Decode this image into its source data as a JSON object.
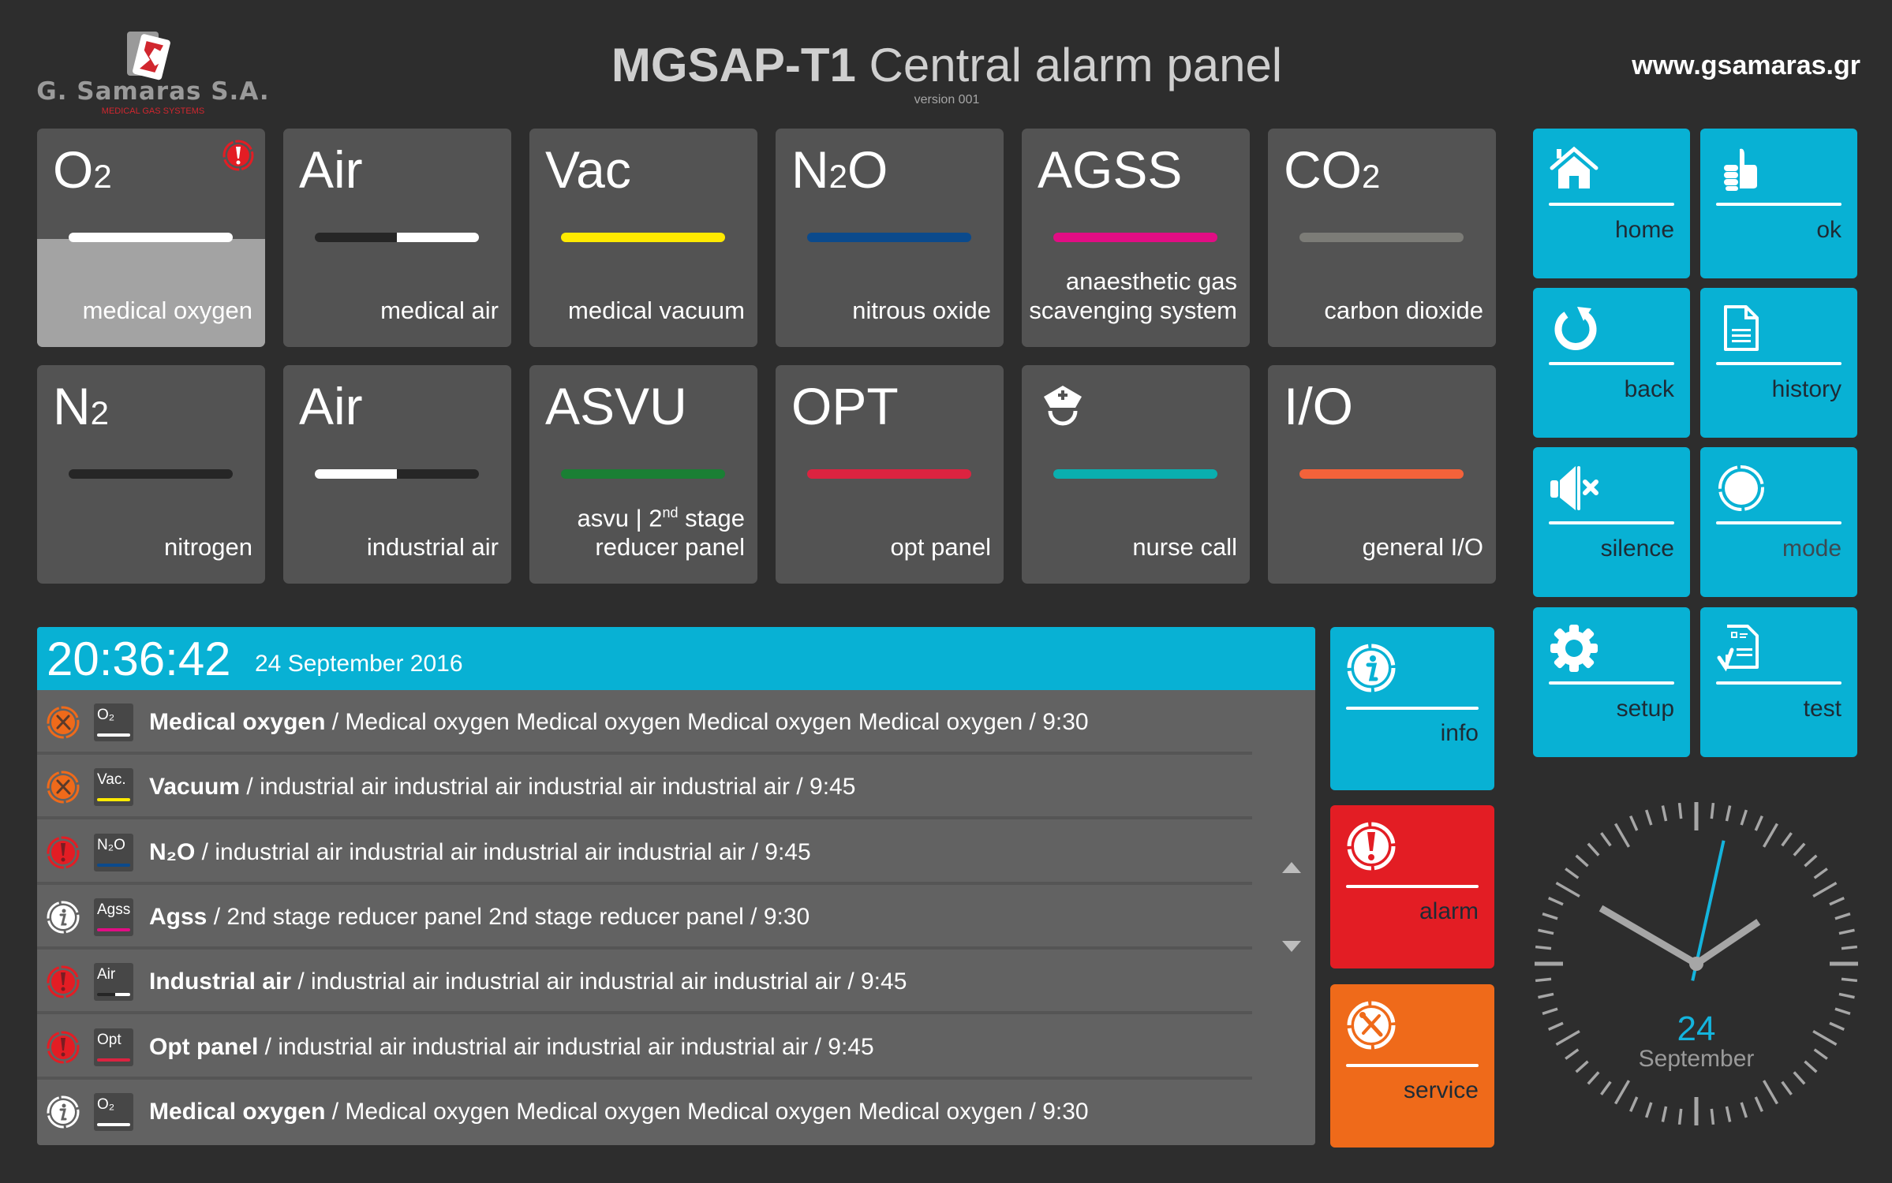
{
  "header": {
    "logo_name": "G. Samaras S.A.",
    "logo_tagline": "MEDICAL GAS SYSTEMS",
    "title_bold": "MGSAP-T1",
    "title_rest": "Central alarm panel",
    "version": "version 001",
    "website": "www.gsamaras.gr"
  },
  "tiles": [
    {
      "code": "O",
      "sub": "2",
      "desc": "medical oxygen",
      "bar": [
        "#ffffff"
      ],
      "selected": true,
      "alert": true
    },
    {
      "code": "Air",
      "sub": "",
      "desc": "medical air",
      "bar": [
        "#262626",
        "#ffffff"
      ]
    },
    {
      "code": "Vac",
      "sub": "",
      "desc": "medical vacuum",
      "bar": [
        "#ffea00"
      ]
    },
    {
      "code": "N",
      "sub": "2",
      "code_after": "O",
      "desc": "nitrous oxide",
      "bar": [
        "#0b4a8c"
      ]
    },
    {
      "code": "AGSS",
      "sub": "",
      "desc_line1": "anaesthetic gas",
      "desc": "scavenging system",
      "bar": [
        "#e20d84"
      ]
    },
    {
      "code": "CO",
      "sub": "2",
      "desc": "carbon dioxide",
      "bar": [
        "#7c7c77"
      ]
    },
    {
      "code": "N",
      "sub": "2",
      "desc": "nitrogen",
      "bar": [
        "#262626"
      ]
    },
    {
      "code": "Air",
      "sub": "",
      "desc": "industrial air",
      "bar": [
        "#ffffff",
        "#262626"
      ]
    },
    {
      "code": "ASVU",
      "sub": "",
      "desc_line1_a": "asvu | 2",
      "desc_line1_sup": "nd",
      "desc_line1_b": " stage",
      "desc": "reducer panel",
      "bar": [
        "#1a7f34"
      ]
    },
    {
      "code": "OPT",
      "sub": "",
      "desc": "opt panel",
      "bar": [
        "#dc2340"
      ]
    },
    {
      "code": "",
      "sub": "",
      "icon": "nurse-icon",
      "desc": "nurse call",
      "bar": [
        "#0aafaf"
      ]
    },
    {
      "code": "I/O",
      "sub": "",
      "desc": "general I/O",
      "bar": [
        "#f4623a"
      ]
    }
  ],
  "nav_buttons": [
    {
      "label": "home",
      "icon": "home-icon"
    },
    {
      "label": "ok",
      "icon": "thumbs-up-icon"
    },
    {
      "label": "back",
      "icon": "refresh-icon"
    },
    {
      "label": "history",
      "icon": "document-icon"
    },
    {
      "label": "silence",
      "icon": "speaker-mute-icon"
    },
    {
      "label": "mode",
      "icon": "circle-mode-icon"
    },
    {
      "label": "setup",
      "icon": "gear-icon"
    },
    {
      "label": "test",
      "icon": "checklist-icon"
    }
  ],
  "side_buttons": [
    {
      "label": "info",
      "icon": "info-icon",
      "color": "#08b1d4"
    },
    {
      "label": "alarm",
      "icon": "alarm-icon",
      "color": "#e31d24"
    },
    {
      "label": "service",
      "icon": "service-icon",
      "color": "#ef6a1a"
    }
  ],
  "log": {
    "time": "20:36:42",
    "date": "24 September 2016",
    "rows": [
      {
        "status": "service",
        "chip": "O₂",
        "chip_bar": [
          "#ffffff"
        ],
        "title": "Medical oxygen",
        "text": " / Medical oxygen Medical oxygen Medical oxygen Medical oxygen  / 9:30"
      },
      {
        "status": "service",
        "chip": "Vac.",
        "chip_bar": [
          "#ffea00"
        ],
        "title": "Vacuum",
        "text": " / industrial air industrial air industrial air industrial air / 9:45"
      },
      {
        "status": "alarm",
        "chip": "N₂O",
        "chip_bar": [
          "#0b4a8c"
        ],
        "title": "N₂O",
        "text": " / industrial air industrial air industrial air industrial air / 9:45"
      },
      {
        "status": "info",
        "chip": "Agss",
        "chip_bar": [
          "#e20d84"
        ],
        "title": "Agss",
        "text": "  / 2nd stage reducer panel 2nd stage reducer panel / 9:30"
      },
      {
        "status": "alarm",
        "chip": "Air",
        "chip_bar": [
          "#262626",
          "#ffffff"
        ],
        "title": "Industrial air",
        "text": " / industrial air industrial air industrial air industrial air / 9:45"
      },
      {
        "status": "alarm",
        "chip": "Opt",
        "chip_bar": [
          "#dc2340"
        ],
        "title": "Opt panel",
        "text": " / industrial air industrial air industrial air industrial air / 9:45"
      },
      {
        "status": "info",
        "chip": "O₂",
        "chip_bar": [
          "#ffffff"
        ],
        "title": "Medical oxygen",
        "text": " / Medical oxygen Medical oxygen Medical oxygen Medical oxygen  / 9:30"
      }
    ]
  },
  "clock": {
    "hour": 1,
    "minute": 50,
    "second": 2,
    "day": "24",
    "month": "September"
  },
  "colors": {
    "accent": "#08b1d4",
    "alarm": "#e31d24",
    "service": "#ef6a1a",
    "tile": "#535353",
    "background": "#2d2d2d"
  }
}
